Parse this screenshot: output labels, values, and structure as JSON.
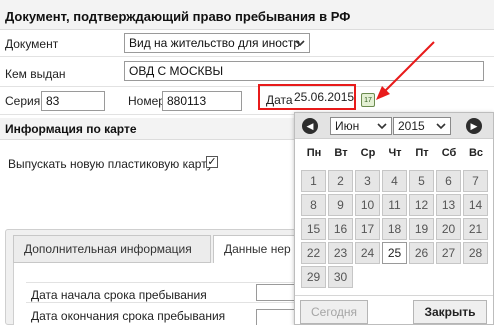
{
  "colors": {
    "highlight": "#e81b1b",
    "arrow": "#e81b1b",
    "calendar_icon": "#6b8b4f"
  },
  "section1": {
    "title": "Документ, подтверждающий право пребывания в РФ",
    "document_label": "Документ",
    "document_value": "Вид на жительство для иностр",
    "issued_by_label": "Кем выдан",
    "issued_by_value": "ОВД С МОСКВЫ",
    "series_label": "Серия",
    "series_value": "83",
    "number_label": "Номер",
    "number_value": "880113",
    "date_label": "Дата",
    "date_value": "25.06.2015",
    "calendar_icon": "calendar-icon",
    "calendar_icon_text": "17"
  },
  "section2": {
    "title": "Информация по карте",
    "new_card_label": "Выпускать новую пластиковую карту",
    "new_card_checked": true,
    "check_mark": "✓"
  },
  "tabs": [
    {
      "label": "Дополнительная информация",
      "active": false
    },
    {
      "label": "Данные нер",
      "active": true
    }
  ],
  "stay": {
    "start_label": "Дата начала срока пребывания",
    "end_label": "Дата окончания срока пребывания"
  },
  "datepicker": {
    "month": "Июн",
    "year": "2015",
    "prev_icon": "◀",
    "next_icon": "▶",
    "weekdays": [
      "Пн",
      "Вт",
      "Ср",
      "Чт",
      "Пт",
      "Сб",
      "Вс"
    ],
    "weeks": [
      [
        "1",
        "2",
        "3",
        "4",
        "5",
        "6",
        "7"
      ],
      [
        "8",
        "9",
        "10",
        "11",
        "12",
        "13",
        "14"
      ],
      [
        "15",
        "16",
        "17",
        "18",
        "19",
        "20",
        "21"
      ],
      [
        "22",
        "23",
        "24",
        "25",
        "26",
        "27",
        "28"
      ],
      [
        "29",
        "30",
        "",
        "",
        "",
        "",
        ""
      ]
    ],
    "selected_day": "25",
    "today_button": "Сегодня",
    "close_button": "Закрыть"
  }
}
